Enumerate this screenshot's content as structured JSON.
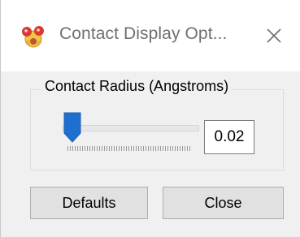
{
  "window": {
    "title": "Contact Display Opt...",
    "icon": "molecule-app-icon",
    "close_icon": "close-icon"
  },
  "group": {
    "label": "Contact Radius (Angstroms)"
  },
  "slider": {
    "level_fraction": 0.02
  },
  "value_field": {
    "value": "0.02"
  },
  "buttons": {
    "defaults_label": "Defaults",
    "close_label": "Close"
  },
  "colors": {
    "thumb": "#1e6fd0",
    "background": "#f0f0f0",
    "titlebar": "#ffffff"
  }
}
